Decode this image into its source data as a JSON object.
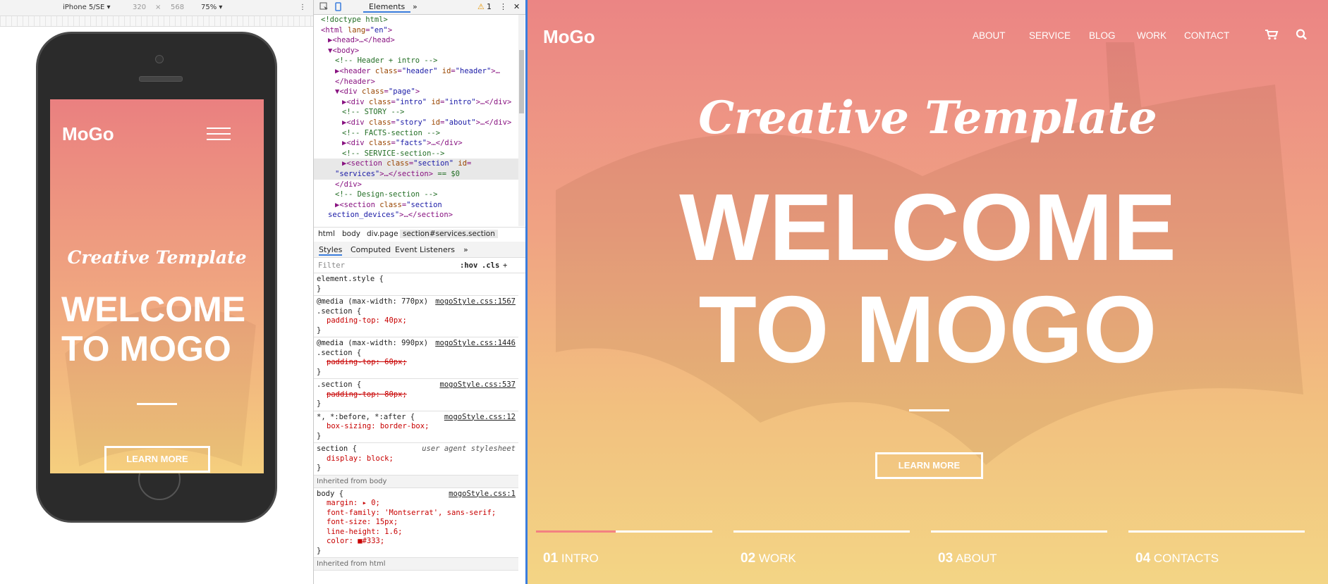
{
  "device_toolbar": {
    "device": "iPhone 5/SE",
    "width": "320",
    "times": "×",
    "height": "568",
    "zoom": "75%"
  },
  "mobile_page": {
    "logo": "MoGo",
    "script_title": "Creative Template",
    "title_line1": "WELCOME",
    "title_line2": "TO MOGO",
    "button": "LEARN MORE"
  },
  "devtools": {
    "tabs": {
      "elements": "Elements",
      "more": "»",
      "warning_count": "1",
      "menu": "⋮",
      "close": "✕"
    },
    "dom": [
      {
        "indent": 0,
        "parts": [
          [
            "cmt",
            "<!doctype html>"
          ]
        ]
      },
      {
        "indent": 0,
        "parts": [
          [
            "tag",
            "<html "
          ],
          [
            "attr",
            "lang"
          ],
          [
            "tag",
            "="
          ],
          [
            "val",
            "\"en\""
          ],
          [
            "tag",
            ">"
          ]
        ]
      },
      {
        "indent": 1,
        "parts": [
          [
            "tag",
            "▶<head>…</head>"
          ]
        ]
      },
      {
        "indent": 1,
        "parts": [
          [
            "tag",
            "▼<body>"
          ]
        ]
      },
      {
        "indent": 2,
        "parts": [
          [
            "cmt",
            "<!-- Header + intro -->"
          ]
        ]
      },
      {
        "indent": 2,
        "parts": [
          [
            "tag",
            "▶<header "
          ],
          [
            "attr",
            "class"
          ],
          [
            "tag",
            "="
          ],
          [
            "val",
            "\"header\""
          ],
          [
            "attr",
            " id"
          ],
          [
            "tag",
            "="
          ],
          [
            "val",
            "\"header\""
          ],
          [
            "tag",
            ">…"
          ]
        ]
      },
      {
        "indent": 2,
        "parts": [
          [
            "tag",
            "</header>"
          ]
        ]
      },
      {
        "indent": 2,
        "parts": [
          [
            "tag",
            "▼<div "
          ],
          [
            "attr",
            "class"
          ],
          [
            "tag",
            "="
          ],
          [
            "val",
            "\"page\""
          ],
          [
            "tag",
            ">"
          ]
        ]
      },
      {
        "indent": 3,
        "parts": [
          [
            "tag",
            "▶<div "
          ],
          [
            "attr",
            "class"
          ],
          [
            "tag",
            "="
          ],
          [
            "val",
            "\"intro\""
          ],
          [
            "attr",
            " id"
          ],
          [
            "tag",
            "="
          ],
          [
            "val",
            "\"intro\""
          ],
          [
            "tag",
            ">…</div>"
          ]
        ]
      },
      {
        "indent": 3,
        "parts": [
          [
            "cmt",
            "<!-- STORY -->"
          ]
        ]
      },
      {
        "indent": 3,
        "parts": [
          [
            "tag",
            "▶<div "
          ],
          [
            "attr",
            "class"
          ],
          [
            "tag",
            "="
          ],
          [
            "val",
            "\"story\""
          ],
          [
            "attr",
            " id"
          ],
          [
            "tag",
            "="
          ],
          [
            "val",
            "\"about\""
          ],
          [
            "tag",
            ">…</div>"
          ]
        ]
      },
      {
        "indent": 3,
        "parts": [
          [
            "cmt",
            "<!-- FACTS-section -->"
          ]
        ]
      },
      {
        "indent": 3,
        "parts": [
          [
            "tag",
            "▶<div "
          ],
          [
            "attr",
            "class"
          ],
          [
            "tag",
            "="
          ],
          [
            "val",
            "\"facts\""
          ],
          [
            "tag",
            ">…</div>"
          ]
        ]
      },
      {
        "indent": 3,
        "parts": [
          [
            "cmt",
            "<!-- SERVICE-section-->"
          ]
        ]
      },
      {
        "indent": 3,
        "selected": true,
        "parts": [
          [
            "tag",
            "▶<section "
          ],
          [
            "attr",
            "class"
          ],
          [
            "tag",
            "="
          ],
          [
            "val",
            "\"section\""
          ],
          [
            "attr",
            " id"
          ],
          [
            "tag",
            "="
          ]
        ]
      },
      {
        "indent": 2,
        "selected": true,
        "parts": [
          [
            "val",
            "\"services\""
          ],
          [
            "tag",
            ">…</section>"
          ],
          [
            "cmt",
            " == $0"
          ]
        ]
      },
      {
        "indent": 2,
        "parts": [
          [
            "tag",
            "</div>"
          ]
        ]
      },
      {
        "indent": 2,
        "parts": [
          [
            "cmt",
            "<!-- Design-section -->"
          ]
        ]
      },
      {
        "indent": 2,
        "parts": [
          [
            "tag",
            "▶<section "
          ],
          [
            "attr",
            "class"
          ],
          [
            "tag",
            "="
          ],
          [
            "val",
            "\"section"
          ]
        ]
      },
      {
        "indent": 1,
        "parts": [
          [
            "val",
            "section_devices\""
          ],
          [
            "tag",
            ">…</section>"
          ]
        ]
      }
    ],
    "breadcrumb": [
      "html",
      "body",
      "div.page",
      "section#services.section"
    ],
    "style_tabs": [
      "Styles",
      "Computed",
      "Event Listeners",
      "»"
    ],
    "filter": {
      "placeholder": "Filter",
      "hov": ":hov",
      "cls": ".cls",
      "add": "+"
    },
    "rules": [
      {
        "lines": [
          [
            "sel",
            "element.style {"
          ],
          [
            "sel",
            "}"
          ]
        ]
      },
      {
        "src": "mogoStyle.css:1567",
        "lines": [
          [
            "sel",
            "@media (max-width: 770px)"
          ],
          [
            "sel",
            ".section {"
          ],
          [
            "prop",
            "padding-top: 40px;"
          ],
          [
            "sel",
            "}"
          ]
        ]
      },
      {
        "src": "mogoStyle.css:1446",
        "lines": [
          [
            "sel",
            "@media (max-width: 990px)"
          ],
          [
            "sel",
            ".section {"
          ],
          [
            "struck",
            "padding-top: 60px;"
          ],
          [
            "sel",
            "}"
          ]
        ]
      },
      {
        "src": "mogoStyle.css:537",
        "lines": [
          [
            "sel",
            ".section {"
          ],
          [
            "struck",
            "padding-top: 80px;"
          ],
          [
            "sel",
            "}"
          ]
        ]
      },
      {
        "src": "mogoStyle.css:12",
        "lines": [
          [
            "sel",
            "*, *:before, *:after {"
          ],
          [
            "prop",
            "box-sizing: border-box;"
          ],
          [
            "sel",
            "}"
          ]
        ]
      },
      {
        "src": "user agent stylesheet",
        "lines": [
          [
            "sel",
            "section {"
          ],
          [
            "prop",
            "display: block;"
          ],
          [
            "sel",
            "}"
          ]
        ]
      }
    ],
    "inherited_body": "Inherited from body",
    "body_rule": {
      "src": "mogoStyle.css:1",
      "lines": [
        [
          "sel",
          "body {"
        ],
        [
          "prop",
          "margin: ▸ 0;"
        ],
        [
          "prop",
          "font-family: 'Montserrat', sans-serif;"
        ],
        [
          "prop",
          "font-size: 15px;"
        ],
        [
          "prop",
          "line-height: 1.6;"
        ],
        [
          "prop",
          "color: ■#333;"
        ],
        [
          "sel",
          "}"
        ]
      ]
    },
    "inherited_html": "Inherited from html"
  },
  "desktop_page": {
    "logo": "MoGo",
    "nav": [
      "ABOUT",
      "SERVICE",
      "BLOG",
      "WORK",
      "CONTACT"
    ],
    "script_title": "Creative Template",
    "title_line1": "WELCOME",
    "title_line2": "TO MOGO",
    "button": "LEARN MORE",
    "steps": [
      {
        "num": "01",
        "label": "INTRO"
      },
      {
        "num": "02",
        "label": "WORK"
      },
      {
        "num": "03",
        "label": "ABOUT"
      },
      {
        "num": "04",
        "label": "CONTACTS"
      }
    ],
    "accent_color": "#f38181"
  }
}
